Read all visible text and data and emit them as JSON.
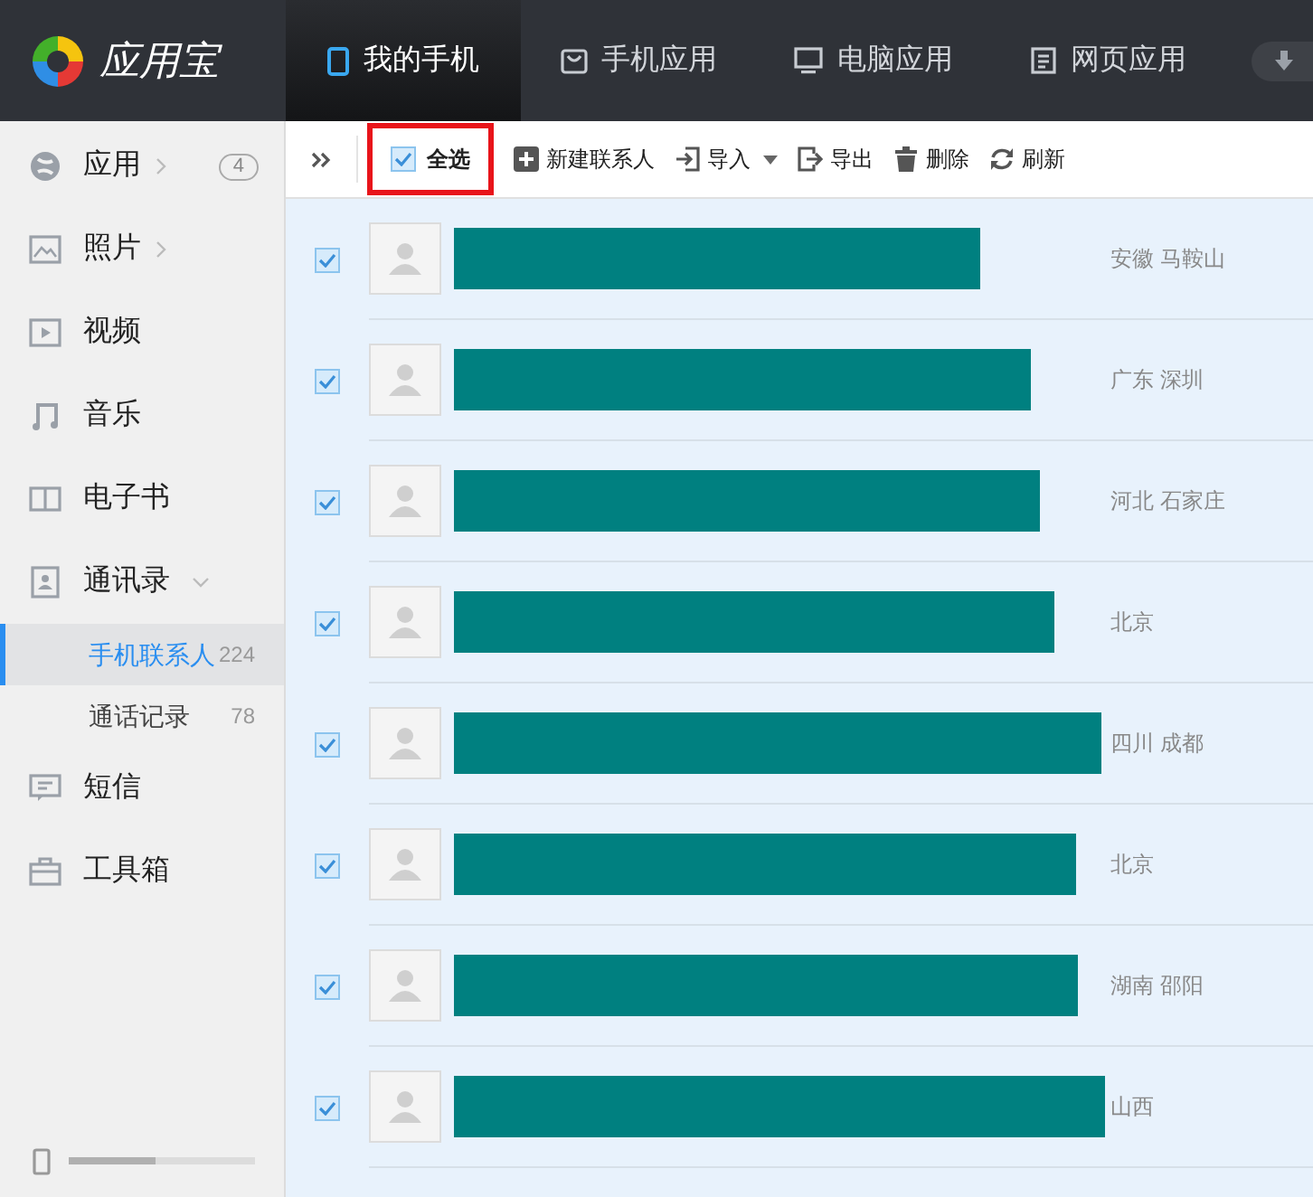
{
  "app": {
    "logo": "应用宝"
  },
  "tabs": [
    {
      "label": "我的手机",
      "selected": true
    },
    {
      "label": "手机应用",
      "selected": false
    },
    {
      "label": "电脑应用",
      "selected": false
    },
    {
      "label": "网页应用",
      "selected": false
    }
  ],
  "sidebar": {
    "items": [
      {
        "label": "应用",
        "expanded": false,
        "badge": "4"
      },
      {
        "label": "照片",
        "expanded": false
      },
      {
        "label": "视频"
      },
      {
        "label": "音乐"
      },
      {
        "label": "电子书"
      },
      {
        "label": "通讯录",
        "expanded": true,
        "children": [
          {
            "label": "手机联系人",
            "count": "224",
            "selected": true
          },
          {
            "label": "通话记录",
            "count": "78",
            "selected": false
          }
        ]
      },
      {
        "label": "短信"
      },
      {
        "label": "工具箱"
      }
    ],
    "storage": {
      "level": 0.47
    }
  },
  "toolbar": {
    "select_all": {
      "label": "全选",
      "checked": true
    },
    "buttons": [
      {
        "label": "新建联系人"
      },
      {
        "label": "导入",
        "dropdown": true
      },
      {
        "label": "导出"
      },
      {
        "label": "删除"
      },
      {
        "label": "刷新"
      }
    ]
  },
  "contacts": [
    {
      "checked": true,
      "location": "安徽 马鞍山"
    },
    {
      "checked": true,
      "location": "广东 深圳"
    },
    {
      "checked": true,
      "location": "河北 石家庄"
    },
    {
      "checked": true,
      "location": "北京"
    },
    {
      "checked": true,
      "location": "四川 成都"
    },
    {
      "checked": true,
      "location": "北京"
    },
    {
      "checked": true,
      "location": "湖南 邵阳"
    },
    {
      "checked": true,
      "location": "山西"
    }
  ]
}
